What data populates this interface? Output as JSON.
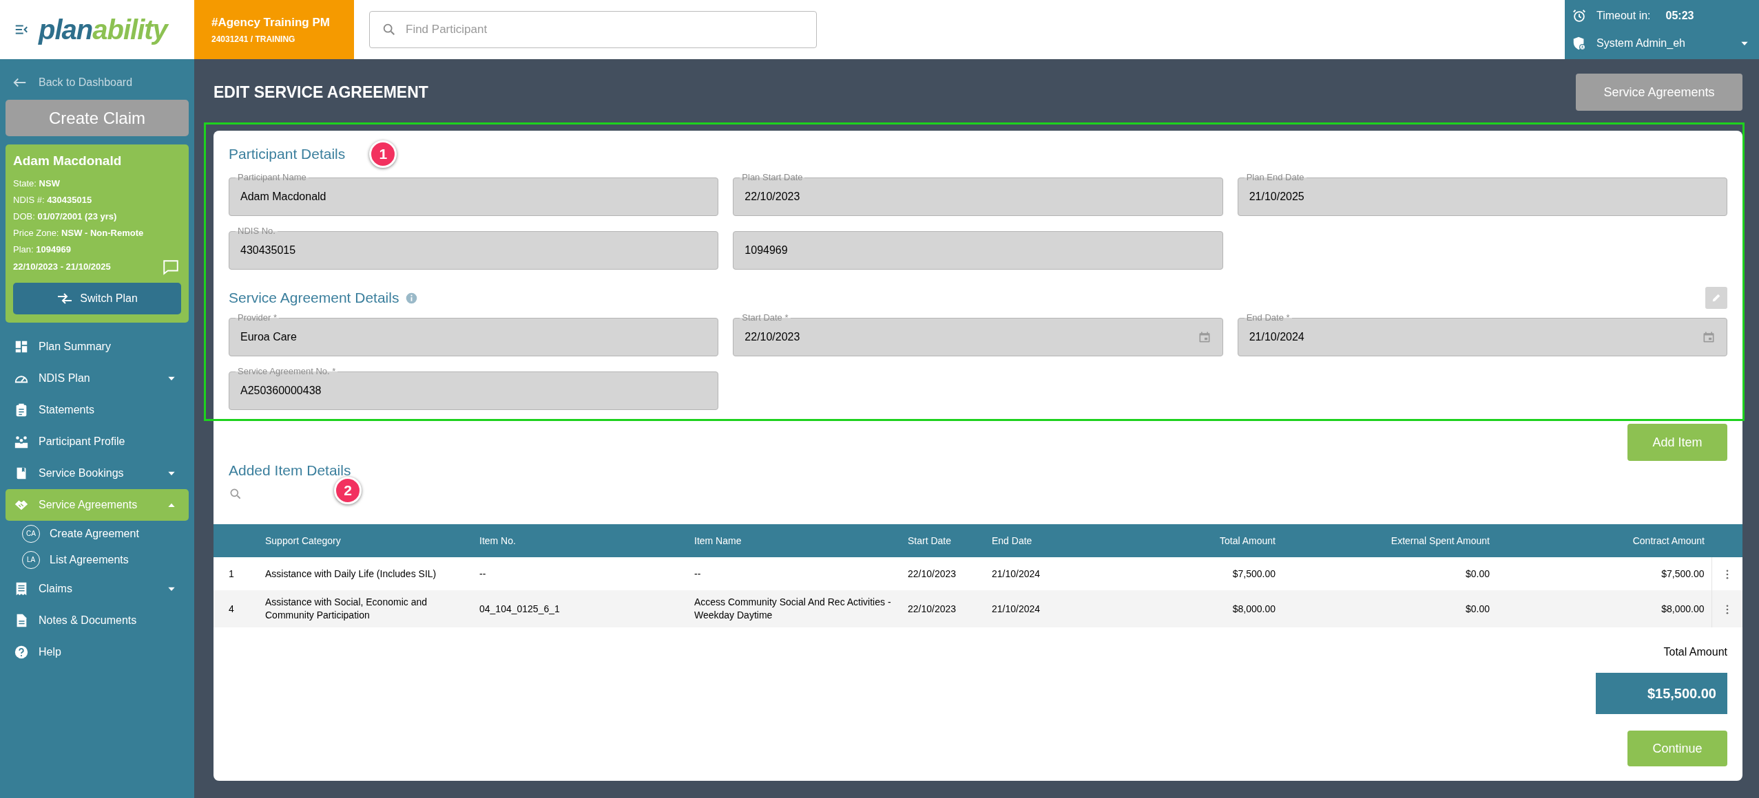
{
  "header": {
    "logo": [
      "plan",
      "ability"
    ],
    "org": {
      "name": "#Agency Training PM",
      "code": "24031241 / TRAINING"
    },
    "search": {
      "placeholder": "Find Participant"
    },
    "session": {
      "timeout_label": "Timeout in:",
      "timeout_value": "05:23",
      "user": "System Admin_eh"
    }
  },
  "sidebar": {
    "back_link": "Back to Dashboard",
    "create_claim": "Create Claim",
    "participant": {
      "name": "Adam Macdonald",
      "details": [
        {
          "label": "State:",
          "value": "NSW"
        },
        {
          "label": "NDIS #:",
          "value": "430435015"
        },
        {
          "label": "DOB:",
          "value": "01/07/2001 (23 yrs)"
        },
        {
          "label": "Price Zone:",
          "value": "NSW - Non-Remote"
        },
        {
          "label": "Plan:",
          "value": "1094969"
        }
      ],
      "plan_dates": "22/10/2023 - 21/10/2025",
      "switch_plan": "Switch Plan"
    },
    "nav": [
      {
        "label": "Plan Summary",
        "kind": "link",
        "selected": false
      },
      {
        "label": "NDIS Plan",
        "kind": "menu",
        "expanded": false,
        "selected": false
      },
      {
        "label": "Statements",
        "kind": "link",
        "selected": false
      },
      {
        "label": "Participant Profile",
        "kind": "link",
        "selected": false
      },
      {
        "label": "Service Bookings",
        "kind": "menu",
        "expanded": false,
        "selected": false
      },
      {
        "label": "Service Agreements",
        "kind": "menu",
        "expanded": true,
        "selected": true,
        "children": [
          {
            "badge": "CA",
            "label": "Create Agreement"
          },
          {
            "badge": "LA",
            "label": "List Agreements"
          }
        ]
      },
      {
        "label": "Claims",
        "kind": "menu",
        "expanded": false,
        "selected": false
      },
      {
        "label": "Notes & Documents",
        "kind": "link",
        "selected": false
      },
      {
        "label": "Help",
        "kind": "link",
        "selected": false
      }
    ]
  },
  "main": {
    "title": "EDIT SERVICE AGREEMENT",
    "top_button": "Service Agreements",
    "participant_details": {
      "heading": "Participant Details",
      "annotation": "1",
      "fields": [
        {
          "label": "Participant Name",
          "value": "Adam Macdonald"
        },
        {
          "label": "Plan Start Date",
          "value": "22/10/2023"
        },
        {
          "label": "Plan End Date",
          "value": "21/10/2025"
        },
        {
          "label": "NDIS No.",
          "value": "430435015"
        },
        {
          "value": "1094969"
        }
      ]
    },
    "agreement_details": {
      "heading": "Service Agreement Details",
      "fields": [
        {
          "label": "Provider *",
          "value": "Euroa Care"
        },
        {
          "label": "Start Date *",
          "value": "22/10/2023",
          "kind": "date"
        },
        {
          "label": "End Date *",
          "value": "21/10/2024",
          "kind": "date"
        },
        {
          "label": "Service Agreement No. *",
          "value": "A250360000438"
        }
      ]
    },
    "add_item": "Add Item",
    "items": {
      "heading": "Added Item Details",
      "annotation": "2",
      "columns": [
        "",
        "Support Category",
        "Item No.",
        "Item Name",
        "Start Date",
        "End Date",
        "Total Amount",
        "External Spent Amount",
        "Contract Amount"
      ],
      "rows": [
        [
          "1",
          "Assistance with Daily Life (Includes SIL)",
          "--",
          "--",
          "22/10/2023",
          "21/10/2024",
          "$7,500.00",
          "$0.00",
          "$7,500.00"
        ],
        [
          "4",
          "Assistance with Social, Economic and Community Participation",
          "04_104_0125_6_1",
          "Access Community Social And Rec Activities - Weekday Daytime",
          "22/10/2023",
          "21/10/2024",
          "$8,000.00",
          "$0.00",
          "$8,000.00"
        ]
      ]
    },
    "total_label": "Total Amount",
    "total_value": "$15,500.00",
    "continue": "Continue"
  }
}
